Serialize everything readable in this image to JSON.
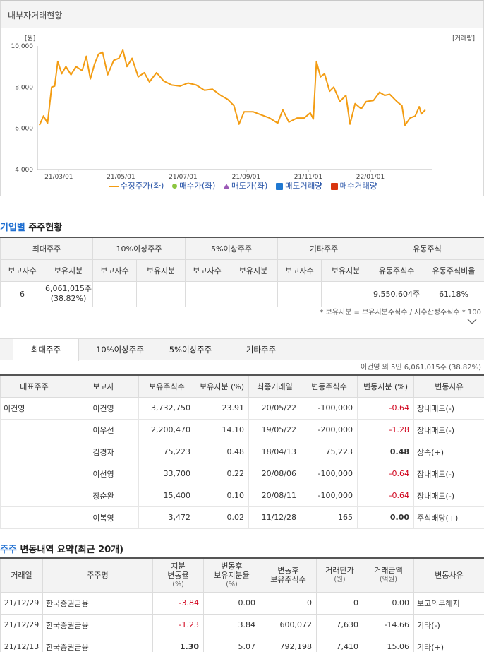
{
  "chart_panel": {
    "title": "내부자거래현황",
    "y_unit": "[원]",
    "y2_unit": "[거래량]",
    "legend": {
      "price": "수정주가(좌)",
      "buy_price": "매수가(좌)",
      "sell_price": "매도가(좌)",
      "sell_volume": "매도거래량",
      "buy_volume": "매수거래량"
    },
    "colors": {
      "price": "#f39c12",
      "buy": "#8cc63f",
      "sell": "#9b59b6",
      "sell_volume": "#1f78d1",
      "buy_volume": "#d9350f"
    }
  },
  "chart_data": {
    "type": "line",
    "title": "내부자거래현황",
    "ylabel": "[원]",
    "y2label": "[거래량]",
    "ylim": [
      4000,
      10000
    ],
    "y_ticks": [
      "10,000",
      "8,000",
      "6,000",
      "4,000"
    ],
    "x_ticks": [
      "21/03/01",
      "21/05/01",
      "21/07/01",
      "21/09/01",
      "21/11/01",
      "22/01/01"
    ],
    "series": [
      {
        "name": "수정주가(좌)",
        "points": [
          [
            "21/02/10",
            6150
          ],
          [
            "21/02/14",
            6600
          ],
          [
            "21/02/18",
            6250
          ],
          [
            "21/02/22",
            8000
          ],
          [
            "21/02/25",
            8050
          ],
          [
            "21/02/28",
            9250
          ],
          [
            "21/03/04",
            8650
          ],
          [
            "21/03/08",
            9000
          ],
          [
            "21/03/13",
            8600
          ],
          [
            "21/03/18",
            9000
          ],
          [
            "21/03/24",
            8800
          ],
          [
            "21/03/28",
            9500
          ],
          [
            "21/04/01",
            8400
          ],
          [
            "21/04/05",
            9100
          ],
          [
            "21/04/09",
            9600
          ],
          [
            "21/04/13",
            9700
          ],
          [
            "21/04/18",
            8600
          ],
          [
            "21/04/24",
            9300
          ],
          [
            "21/04/29",
            9400
          ],
          [
            "21/05/03",
            9800
          ],
          [
            "21/05/07",
            9000
          ],
          [
            "21/05/12",
            9400
          ],
          [
            "21/05/18",
            8500
          ],
          [
            "21/05/24",
            8700
          ],
          [
            "21/05/29",
            8250
          ],
          [
            "21/06/05",
            8700
          ],
          [
            "21/06/12",
            8300
          ],
          [
            "21/06/20",
            8100
          ],
          [
            "21/06/28",
            8050
          ],
          [
            "21/07/06",
            8200
          ],
          [
            "21/07/14",
            8100
          ],
          [
            "21/07/22",
            7850
          ],
          [
            "21/07/30",
            7900
          ],
          [
            "21/08/07",
            7600
          ],
          [
            "21/08/14",
            7400
          ],
          [
            "21/08/20",
            7100
          ],
          [
            "21/08/25",
            6200
          ],
          [
            "21/08/30",
            6800
          ],
          [
            "21/09/08",
            6800
          ],
          [
            "21/09/16",
            6650
          ],
          [
            "21/09/24",
            6500
          ],
          [
            "21/10/02",
            6250
          ],
          [
            "21/10/07",
            6900
          ],
          [
            "21/10/13",
            6300
          ],
          [
            "21/10/21",
            6500
          ],
          [
            "21/10/28",
            6500
          ],
          [
            "21/11/03",
            6750
          ],
          [
            "21/11/06",
            6450
          ],
          [
            "21/11/09",
            9250
          ],
          [
            "21/11/13",
            8500
          ],
          [
            "21/11/17",
            8650
          ],
          [
            "21/11/22",
            7800
          ],
          [
            "21/11/26",
            8000
          ],
          [
            "21/12/02",
            7300
          ],
          [
            "21/12/08",
            7600
          ],
          [
            "21/12/12",
            6200
          ],
          [
            "21/12/17",
            7200
          ],
          [
            "21/12/23",
            6950
          ],
          [
            "21/12/28",
            7300
          ],
          [
            "22/01/04",
            7350
          ],
          [
            "22/01/10",
            7750
          ],
          [
            "22/01/15",
            7600
          ],
          [
            "22/01/20",
            7650
          ],
          [
            "22/01/27",
            7300
          ],
          [
            "22/02/01",
            7100
          ],
          [
            "22/02/04",
            6150
          ],
          [
            "22/02/09",
            6500
          ],
          [
            "22/02/14",
            6600
          ],
          [
            "22/02/18",
            7050
          ],
          [
            "22/02/20",
            6700
          ],
          [
            "22/02/24",
            6900
          ]
        ]
      }
    ],
    "legend": [
      "수정주가(좌)",
      "매수가(좌)",
      "매도가(좌)",
      "매도거래량",
      "매수거래량"
    ],
    "legend_position": "bottom",
    "grid": false
  },
  "holders_section": {
    "title_highlight": "기업별",
    "title_rest": " 주주현황",
    "groups": [
      "최대주주",
      "10%이상주주",
      "5%이상주주",
      "기타주주",
      "유동주식"
    ],
    "subheaders": [
      "보고자수",
      "보유지분",
      "보고자수",
      "보유지분",
      "보고자수",
      "보유지분",
      "보고자수",
      "보유지분",
      "유동주식수",
      "유동주식비율"
    ],
    "row": [
      "6",
      "6,061,015주",
      "(38.82%)",
      "",
      "",
      "",
      "",
      "",
      "",
      "9,550,604주",
      "61.18%"
    ],
    "note": "* 보유지분 = 보유지분주식수 / 지수산정주식수 * 100"
  },
  "tabs": {
    "items": [
      "최대주주",
      "10%이상주주",
      "5%이상주주",
      "기타주주"
    ],
    "summary": "이건영 외 5인 6,061,015주 (38.82%)"
  },
  "major_table": {
    "headers": [
      "대표주주",
      "보고자",
      "보유주식수",
      "보유지분 (%)",
      "최종거래일",
      "변동주식수",
      "변동지분 (%)",
      "변동사유"
    ],
    "rows": [
      [
        "이건영",
        "이건영",
        "3,732,750",
        "23.91",
        "20/05/22",
        "-100,000",
        "-0.64",
        "장내매도(-)"
      ],
      [
        "",
        "이우선",
        "2,200,470",
        "14.10",
        "19/05/22",
        "-200,000",
        "-1.28",
        "장내매도(-)"
      ],
      [
        "",
        "김경자",
        "75,223",
        "0.48",
        "18/04/13",
        "75,223",
        "0.48",
        "상속(+)"
      ],
      [
        "",
        "이선영",
        "33,700",
        "0.22",
        "20/08/06",
        "-100,000",
        "-0.64",
        "장내매도(-)"
      ],
      [
        "",
        "장순완",
        "15,400",
        "0.10",
        "20/08/11",
        "-100,000",
        "-0.64",
        "장내매도(-)"
      ],
      [
        "",
        "이복영",
        "3,472",
        "0.02",
        "11/12/28",
        "165",
        "0.00",
        "주식배당(+)"
      ]
    ]
  },
  "change_section": {
    "title_highlight": "주주",
    "title_rest": " 변동내역 요약(최근 20개)",
    "headers": [
      [
        "거래일"
      ],
      [
        "주주명"
      ],
      [
        "지분",
        "변동율",
        "(%)"
      ],
      [
        "변동후",
        "보유지분율",
        "(%)"
      ],
      [
        "변동후",
        "보유주식수"
      ],
      [
        "거래단가",
        "(원)"
      ],
      [
        "거래금액",
        "(억원)"
      ],
      [
        "변동사유"
      ]
    ],
    "rows": [
      [
        "21/12/29",
        "한국증권금융",
        "-3.84",
        "0.00",
        "0",
        "0",
        "0.00",
        "보고의무해지"
      ],
      [
        "21/12/29",
        "한국증권금융",
        "-1.23",
        "3.84",
        "600,072",
        "7,630",
        "-14.66",
        "기타(-)"
      ],
      [
        "21/12/13",
        "한국증권금융",
        "1.30",
        "5.07",
        "792,198",
        "7,410",
        "15.06",
        "기타(+)"
      ]
    ]
  }
}
